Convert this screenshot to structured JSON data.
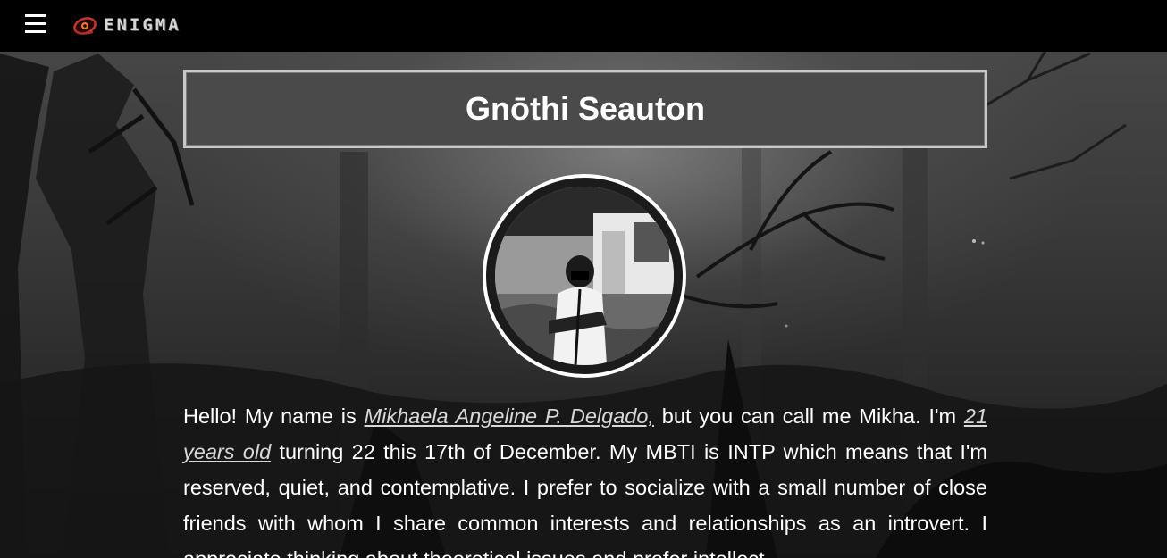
{
  "navbar": {
    "menu_icon": "hamburger-menu-icon",
    "logo_icon": "eye-logo-icon",
    "logo_text": "ENIGMA"
  },
  "title": "Gnōthi Seauton",
  "avatar": {
    "icon": "profile-photo"
  },
  "bio": {
    "part1": "Hello! My name is ",
    "name_link": "Mikhaela Angeline P. Delgado,",
    "part2": " but you can call me Mikha. I'm ",
    "age_link": "21 years old",
    "part3": " turning 22 this 17th of December. My MBTI is INTP which means that I'm reserved, quiet, and contemplative. I prefer to socialize with a small number of close friends with whom I share common interests and relationships as an introvert. I appreciate thinking about theoretical issues and prefer intellect"
  },
  "colors": {
    "navbar_bg": "#000000",
    "title_box_bg": "#4a4a4a",
    "title_box_border": "#c8c8c8",
    "text": "#ffffff"
  }
}
